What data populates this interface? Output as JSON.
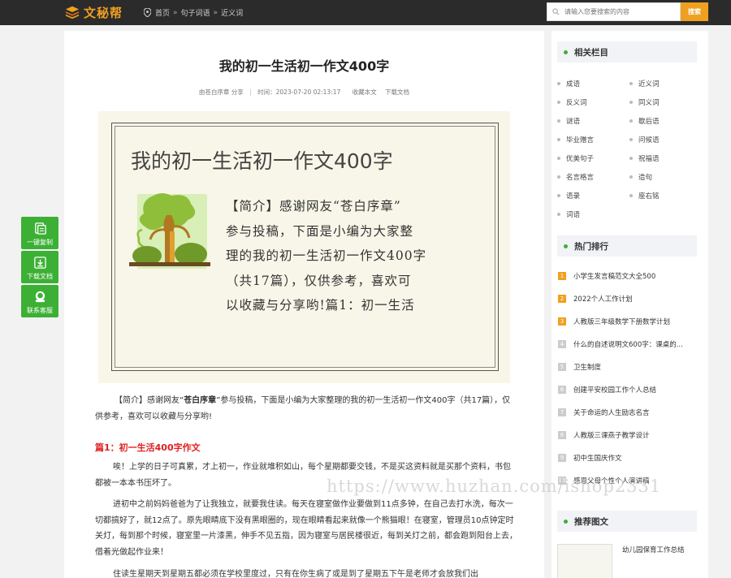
{
  "header": {
    "logo_text": "文秘帮",
    "breadcrumb": [
      "首页",
      "句子词语",
      "近义词"
    ],
    "search_placeholder": "请输入您要搜索的内容",
    "search_button": "搜索",
    "accent_color": "#f0a020"
  },
  "article": {
    "title": "我的初一生活初一作文400字",
    "meta": {
      "source": "由苍白序章 分享",
      "time": "时间：2023-07-20 02:13:17",
      "bookmark": "收藏本文",
      "download": "下载文档"
    },
    "cover": {
      "title": "我的初一生活初一作文400字",
      "lines": [
        "【简介】感谢网友“苍白序章”",
        "参与投稿，下面是小编为大家整",
        "理的我的初一生活初一作文400字",
        "（共17篇），仅供参考，喜欢可",
        "以收藏与分享哟!篇1：初一生活"
      ]
    },
    "intro_prefix": "【简介】感谢网友“",
    "intro_author": "苍白序章",
    "intro_suffix": "”参与投稿，下面是小编为大家整理的我的初一生活初一作文400字（共17篇），仅供参考，喜欢可以收藏与分享哟!",
    "section1_title": "篇1：初一生活400字作文",
    "paragraphs": [
      "唉！上学的日子可真累，才上初一，作业就堆积如山，每个星期都要交钱，不是买这资料就是买那个资料，书包都被一本本书压坏了。",
      "进初中之前妈妈爸爸为了让我独立，就要我住读。每天在寝室做作业要做到11点多钟，在自己去打水洗，每次一切都搞好了，就12点了。原先眼睛底下没有黑眼圈的，现在眼睛看起来就像一个熊猫眼！在寝室，管理员10点钟定时关灯，每到那个时候，寝室里一片漆黑，伸手不见五指，因为寝室与居民楼很近，每到关灯之前，都会跑到阳台上去，借着光做起作业来！",
      "住读生星期天到星期五都必须在学校里度过，只有在你生病了或是到了星期五下午是老师才会放我们出"
    ]
  },
  "float_buttons": [
    "一键复制",
    "下载文档",
    "联系客服"
  ],
  "sidebar": {
    "related_title": "相关栏目",
    "related_tags": [
      "成语",
      "近义词",
      "反义词",
      "同义词",
      "谜语",
      "歇后语",
      "毕业赠言",
      "问候语",
      "优美句子",
      "祝福语",
      "名言格言",
      "造句",
      "语录",
      "座右铭",
      "词语"
    ],
    "hot_title": "热门排行",
    "hot_items": [
      "小学生发言稿范文大全500",
      "2022个人工作计划",
      "人教版三年级数学下册数学计划",
      "什么的自述说明文600字：课桌的...",
      "卫生制度",
      "创建平安校园工作个人总结",
      "关于命运的人生励志名言",
      "人教版三课燕子教学设计",
      "初中生国庆作文",
      "感恩父母个性个人演讲稿"
    ],
    "hot_numbers": [
      "1",
      "2",
      "3",
      "4",
      "5",
      "6",
      "7",
      "8",
      "9",
      "10"
    ],
    "rec_title": "推荐图文",
    "rec_item": "幼儿园保育工作总结"
  },
  "watermark": "https://www.huzhan.com/ishop2331"
}
